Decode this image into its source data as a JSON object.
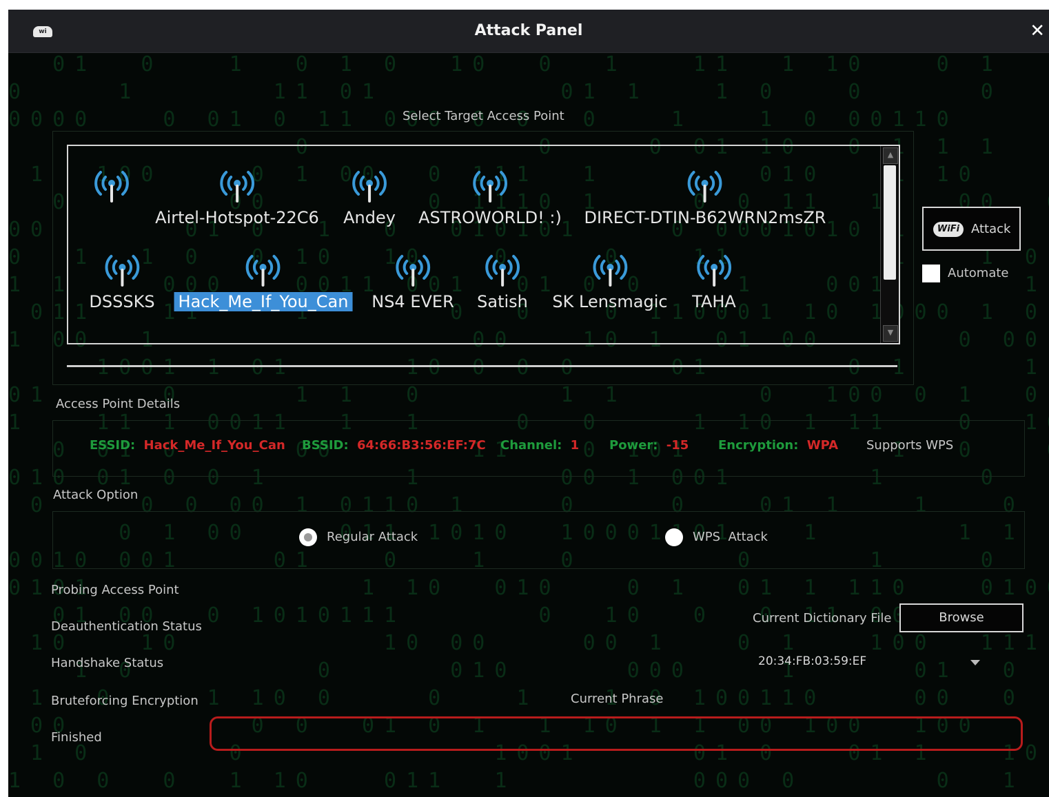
{
  "window": {
    "title": "Attack Panel",
    "app_icon": "wifi-logo-icon",
    "close_glyph": "✕"
  },
  "select_target": {
    "label": "Select Target Access Point",
    "access_points": [
      {
        "name": ""
      },
      {
        "name": "Airtel-Hotspot-22C6"
      },
      {
        "name": "Andey"
      },
      {
        "name": "ASTROWORLD! :)"
      },
      {
        "name": "DIRECT-DTIN-B62WRN2msZR"
      },
      {
        "name": "DSSSKS"
      },
      {
        "name": "Hack_Me_If_You_Can",
        "selected": true
      },
      {
        "name": "NS4 EVER"
      },
      {
        "name": "Satish"
      },
      {
        "name": "SK Lensmagic"
      },
      {
        "name": "TAHA"
      }
    ]
  },
  "side": {
    "attack_label": "Attack",
    "attack_badge": "WiFi",
    "automate_label": "Automate"
  },
  "details": {
    "label": "Access Point Details",
    "essid_key": "ESSID:",
    "essid": "Hack_Me_If_You_Can",
    "bssid_key": "BSSID:",
    "bssid": "64:66:B3:56:EF:7C",
    "channel_key": "Channel:",
    "channel": "1",
    "power_key": "Power:",
    "power": "-15",
    "encryption_key": "Encryption:",
    "encryption": "WPA",
    "wps_note": "Supports WPS"
  },
  "attack_option": {
    "label": "Attack Option",
    "regular": "Regular Attack",
    "wps": "WPS  Attack",
    "selected": "regular"
  },
  "status": {
    "probing": "Probing Access Point",
    "deauth": "Deauthentication Status",
    "handshake": "Handshake Status",
    "bruteforce": "Bruteforcing Encryption",
    "finished": "Finished"
  },
  "dictionary": {
    "label": "Current Dictionary File",
    "browse": "Browse",
    "selected_value": "20:34:FB:03:59:EF"
  },
  "phrase": {
    "label": "Current Phrase",
    "value": ""
  },
  "colors": {
    "accent_blue": "#3d8fd8",
    "key_green": "#1e9b3c",
    "value_red": "#d42828",
    "icon_blue": "#3a9ad9",
    "phrase_border": "#b81c1c"
  }
}
